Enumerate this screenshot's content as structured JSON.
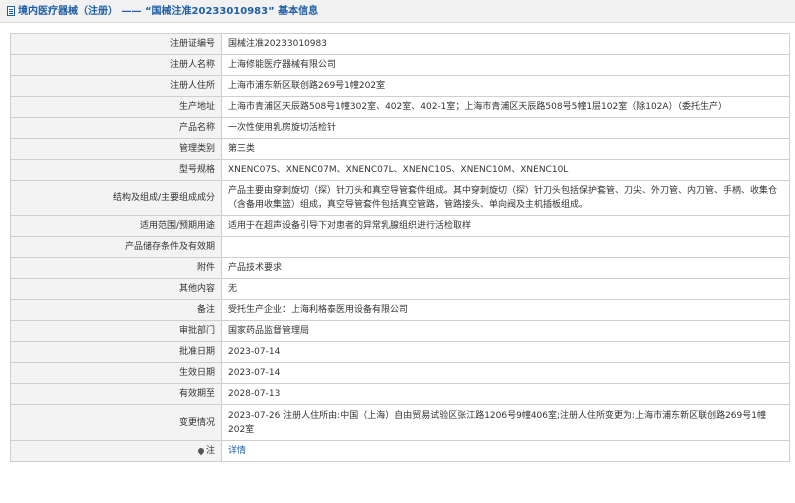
{
  "header": {
    "title": "境内医疗器械（注册） —— “国械注准20233010983” 基本信息",
    "icon": "document-icon"
  },
  "rows": [
    {
      "label": "注册证编号",
      "value": "国械注准20233010983"
    },
    {
      "label": "注册人名称",
      "value": "上海修能医疗器械有限公司"
    },
    {
      "label": "注册人住所",
      "value": "上海市浦东新区联创路269号1幢202室"
    },
    {
      "label": "生产地址",
      "value": "上海市青浦区天辰路508号1幢302室、402室、402-1室；上海市青浦区天辰路508号5幢1层102室（除102A）（委托生产）"
    },
    {
      "label": "产品名称",
      "value": "一次性使用乳房旋切活检针"
    },
    {
      "label": "管理类别",
      "value": "第三类"
    },
    {
      "label": "型号规格",
      "value": "XNENC07S、XNENC07M、XNENC07L、XNENC10S、XNENC10M、XNENC10L"
    },
    {
      "label": "结构及组成/主要组成成分",
      "value": "产品主要由穿刺旋切（探）针刀头和真空导管套件组成。其中穿刺旋切（探）针刀头包括保护套管、刀尖、外刀管、内刀管、手柄、收集仓（含备用收集篮）组成，真空导管套件包括真空管路，管路接头、单向阀及主机插板组成。"
    },
    {
      "label": "适用范围/预期用途",
      "value": "适用于在超声设备引导下对患者的异常乳腺组织进行活检取样"
    },
    {
      "label": "产品储存条件及有效期",
      "value": ""
    },
    {
      "label": "附件",
      "value": "产品技术要求"
    },
    {
      "label": "其他内容",
      "value": "无"
    },
    {
      "label": "备注",
      "value": "受托生产企业：上海利格泰医用设备有限公司"
    },
    {
      "label": "审批部门",
      "value": "国家药品监督管理局"
    },
    {
      "label": "批准日期",
      "value": "2023-07-14"
    },
    {
      "label": "生效日期",
      "value": "2023-07-14"
    },
    {
      "label": "有效期至",
      "value": "2028-07-13"
    },
    {
      "label": "变更情况",
      "value": "2023-07-26 注册人住所由:中国（上海）自由贸易试验区张江路1206号9幢406室;注册人住所变更为:上海市浦东新区联创路269号1幢202室"
    }
  ],
  "note_row": {
    "label": "注",
    "link": "详情",
    "icon": "pin-icon"
  }
}
